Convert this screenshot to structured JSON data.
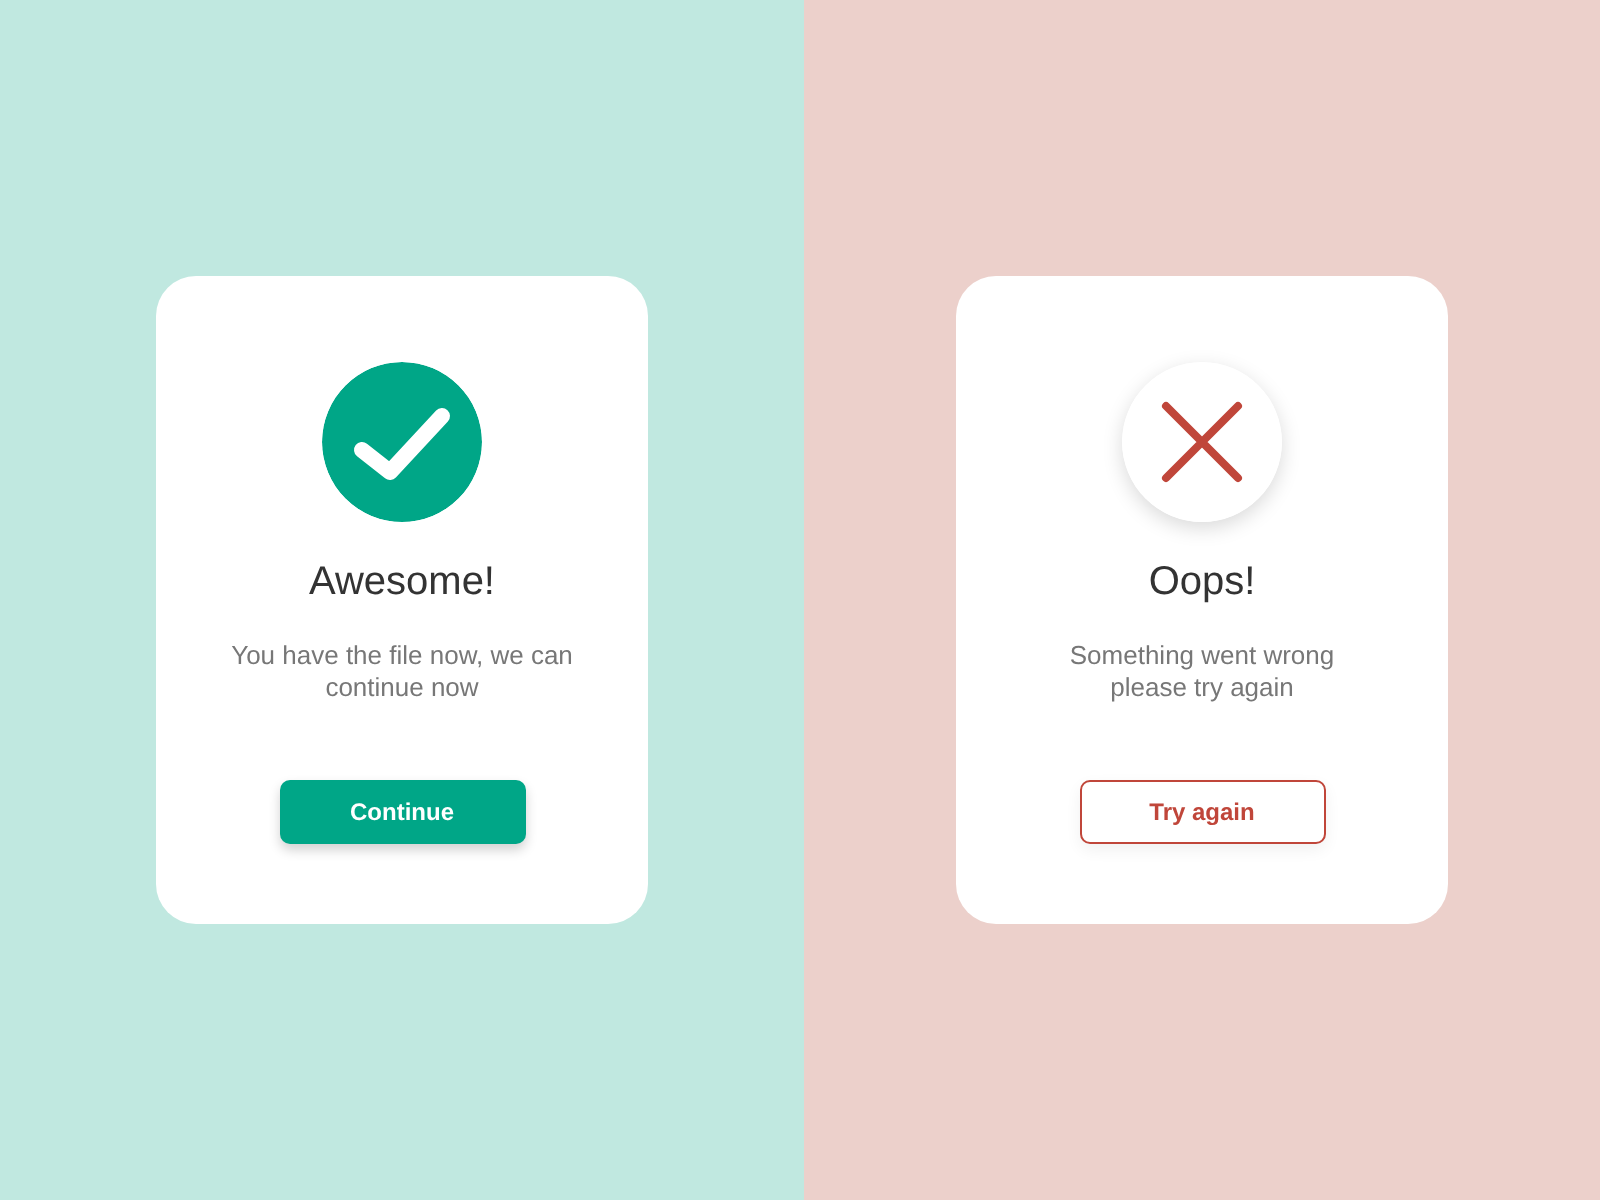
{
  "panels": [
    {
      "kind": "success",
      "title": "Awesome!",
      "message": "You have the file now, we can\ncontinue now",
      "button": "Continue"
    },
    {
      "kind": "error",
      "title": "Oops!",
      "message": "Something went wrong\nplease try again",
      "button": "Try again"
    }
  ]
}
